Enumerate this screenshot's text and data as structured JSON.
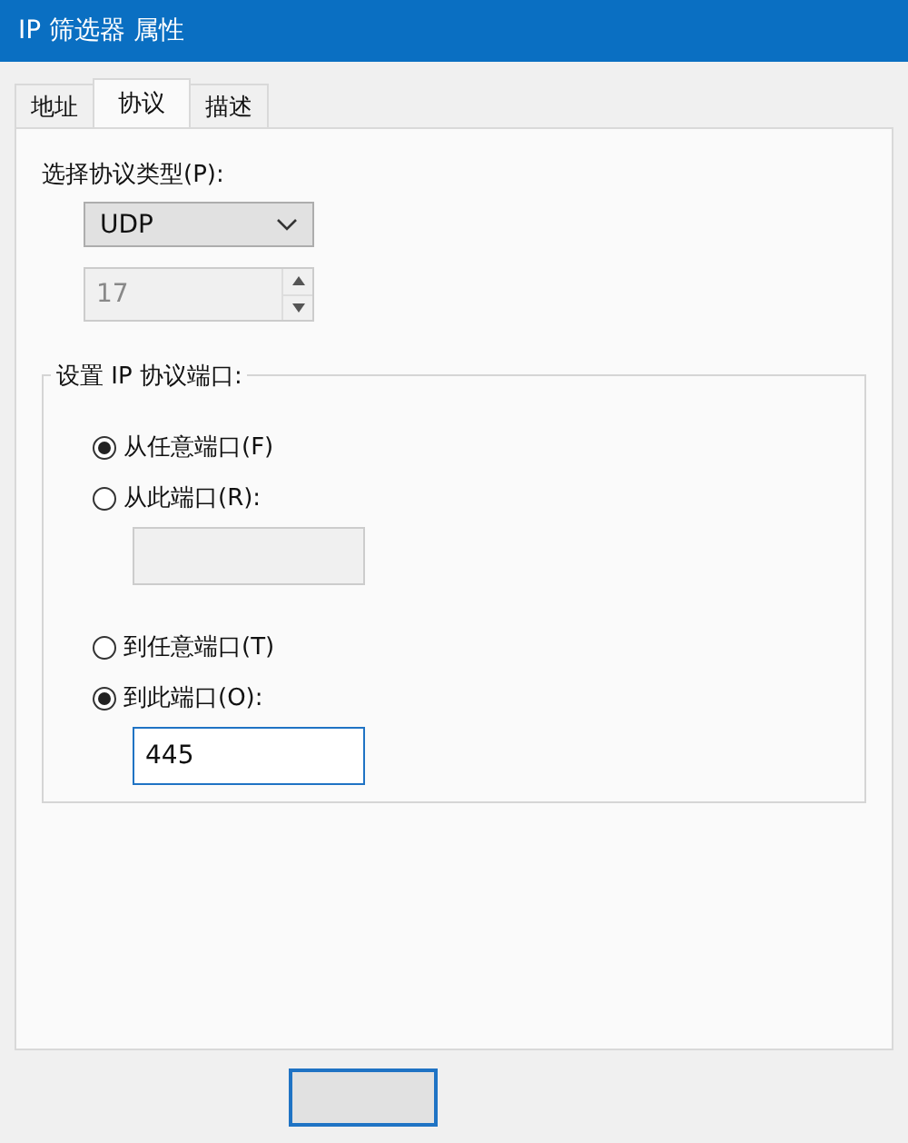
{
  "window": {
    "title": "IP 筛选器 属性"
  },
  "tabs": [
    {
      "label": "地址",
      "selected": false
    },
    {
      "label": "协议",
      "selected": true
    },
    {
      "label": "描述",
      "selected": false
    }
  ],
  "protocol_type": {
    "label": "选择协议类型(P):",
    "value": "UDP"
  },
  "protocol_number": {
    "value": "17",
    "disabled": true
  },
  "port_group": {
    "title": "设置 IP 协议端口:",
    "options": [
      {
        "label": "从任意端口(F)",
        "selected": true
      },
      {
        "label": "从此端口(R):",
        "selected": false,
        "field": {
          "disabled": true
        }
      },
      {
        "label": "到任意端口(T)",
        "selected": false
      },
      {
        "label": "到此端口(O):",
        "selected": true,
        "field": {
          "disabled": false,
          "value": "445"
        }
      }
    ]
  },
  "buttons": [
    {
      "default": true
    }
  ]
}
